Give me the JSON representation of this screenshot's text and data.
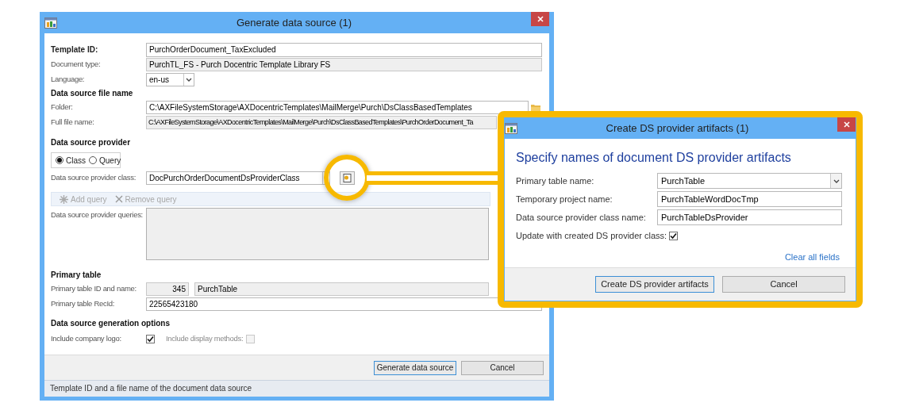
{
  "main_window": {
    "title": "Generate data source (1)",
    "template_id": {
      "label": "Template ID:",
      "value": "PurchOrderDocument_TaxExcluded"
    },
    "document_type": {
      "label": "Document type:",
      "value": "PurchTL_FS - Purch Docentric Template Library FS"
    },
    "language": {
      "label": "Language:",
      "value": "en-us"
    },
    "file_name_section": "Data source file name",
    "folder": {
      "label": "Folder:",
      "value": "C:\\AXFileSystemStorage\\AXDocentricTemplates\\MailMerge\\Purch\\DsClassBasedTemplates"
    },
    "full_file_name": {
      "label": "Full file name:",
      "value": "C:\\AXFileSystemStorage\\AXDocentricTemplates\\MailMerge\\Purch\\DsClassBasedTemplates\\PurchOrderDocument_Ta"
    },
    "provider_section": "Data source provider",
    "provider_types": [
      {
        "label": "Class",
        "selected": true
      },
      {
        "label": "Query",
        "selected": false
      }
    ],
    "provider_class": {
      "label": "Data source provider class:",
      "value": "DocPurchOrderDocumentDsProviderClass"
    },
    "toolbar": [
      {
        "label": "Add query",
        "kind": "add",
        "disabled": true
      },
      {
        "label": "Remove query",
        "kind": "remove",
        "disabled": true
      }
    ],
    "queries": {
      "label": "Data source provider queries:"
    },
    "primary_table_section": "Primary table",
    "primary_table_id": {
      "label": "Primary table ID and name:",
      "id": "345",
      "name": "PurchTable"
    },
    "recid": {
      "label": "Primary table RecId:",
      "value": "22565423180"
    },
    "options_section": "Data source generation options",
    "options": [
      {
        "label": "Include company logo:",
        "checked": true,
        "disabled": false
      },
      {
        "label": "Include display methods:",
        "checked": false,
        "disabled": true
      }
    ],
    "buttons": [
      {
        "label": "Generate data source",
        "default": true
      },
      {
        "label": "Cancel",
        "default": false
      }
    ],
    "status_bar": "Template ID and a file name of the document data source"
  },
  "dialog": {
    "title": "Create DS provider artifacts (1)",
    "heading": "Specify names of document DS provider artifacts",
    "fields": [
      {
        "label": "Primary table name:",
        "value": "PurchTable",
        "kind": "dropdown"
      },
      {
        "label": "Temporary project name:",
        "value": "PurchTableWordDocTmp",
        "kind": "text"
      },
      {
        "label": "Data source provider class name:",
        "value": "PurchTableDsProvider",
        "kind": "text"
      }
    ],
    "update_checkbox": {
      "label": "Update with created DS provider class:",
      "checked": true
    },
    "link": "Clear all fields",
    "buttons": [
      {
        "label": "Create DS provider artifacts",
        "default": true
      },
      {
        "label": "Cancel",
        "default": false
      }
    ]
  }
}
